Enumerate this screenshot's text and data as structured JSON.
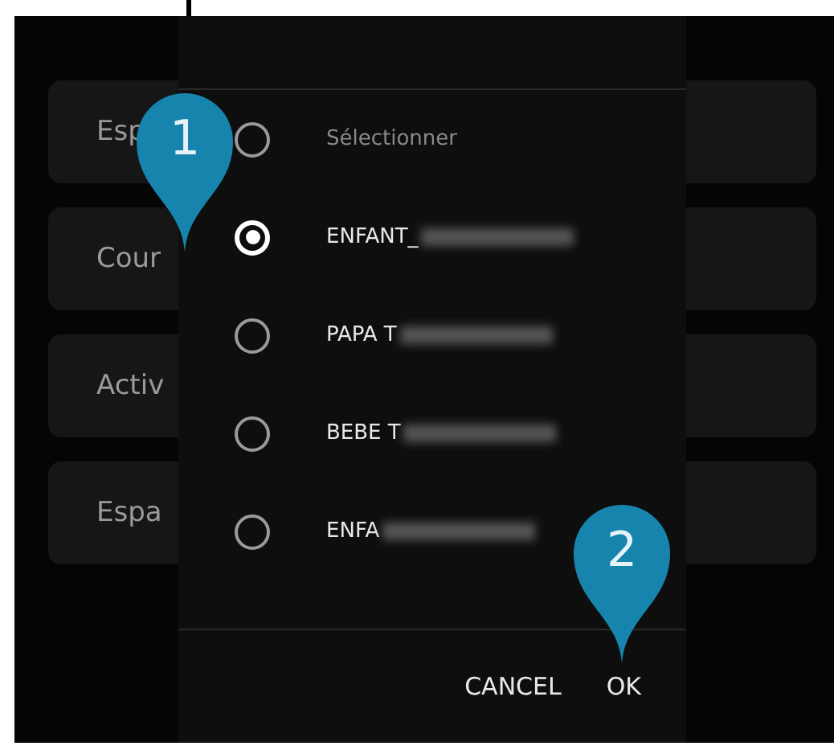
{
  "background_cards": [
    {
      "label": "Esp"
    },
    {
      "label": "Cour"
    },
    {
      "label": "Activ"
    },
    {
      "label": "Espa"
    }
  ],
  "dialog": {
    "options": [
      {
        "kind": "prompt",
        "label": "Sélectionner",
        "selected": false,
        "redacted": false
      },
      {
        "kind": "option",
        "label": "ENFANT_",
        "selected": true,
        "redacted": true
      },
      {
        "kind": "option",
        "label": "PAPA T",
        "selected": false,
        "redacted": true
      },
      {
        "kind": "option",
        "label": "BEBE T",
        "selected": false,
        "redacted": true
      },
      {
        "kind": "option",
        "label": "ENFA",
        "selected": false,
        "redacted": true
      }
    ],
    "buttons": [
      "CANCEL",
      "OK"
    ]
  },
  "markers": [
    {
      "number": "1"
    },
    {
      "number": "2"
    }
  ]
}
